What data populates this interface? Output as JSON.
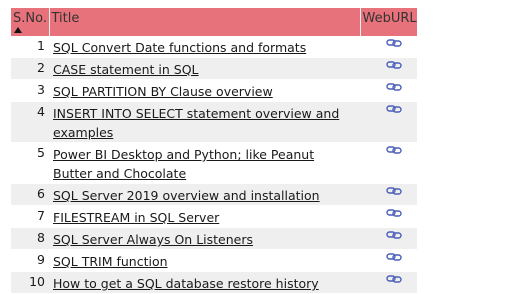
{
  "table": {
    "headers": {
      "sno": "S.No.",
      "title": "Title",
      "weburl": "WebURL"
    },
    "link_icon": "chain-link-icon",
    "link_color": "#4a5fb8",
    "header_color": "#e8727b",
    "rows": [
      {
        "sno": "1",
        "title": "SQL Convert Date functions and formats"
      },
      {
        "sno": "2",
        "title": "CASE statement in SQL"
      },
      {
        "sno": "3",
        "title": "SQL PARTITION BY Clause overview"
      },
      {
        "sno": "4",
        "title": "INSERT INTO SELECT statement overview and examples"
      },
      {
        "sno": "5",
        "title": "Power BI Desktop and Python; like Peanut Butter and Chocolate"
      },
      {
        "sno": "6",
        "title": "SQL Server 2019 overview and installation"
      },
      {
        "sno": "7",
        "title": "FILESTREAM in SQL Server"
      },
      {
        "sno": "8",
        "title": "SQL Server Always On Listeners"
      },
      {
        "sno": "9",
        "title": "SQL TRIM function"
      },
      {
        "sno": "10",
        "title": "How to get a SQL database restore history"
      }
    ]
  }
}
